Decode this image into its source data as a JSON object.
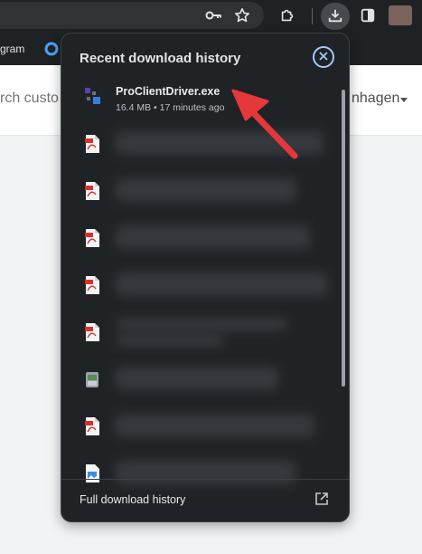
{
  "bookmarks": {
    "partial_label": "gram"
  },
  "page": {
    "search_fragment": "rch custo",
    "account_fragment": "nhagen"
  },
  "download_bubble": {
    "title": "Recent download history",
    "items": [
      {
        "name": "ProClientDriver.exe",
        "meta": "16.4 MB • 17 minutes ago",
        "icon": "exe-app-icon"
      },
      {
        "icon": "pdf-file-icon"
      },
      {
        "icon": "pdf-file-icon"
      },
      {
        "icon": "pdf-file-icon"
      },
      {
        "icon": "pdf-file-icon"
      },
      {
        "icon": "pdf-file-icon"
      },
      {
        "icon": "installer-file-icon"
      },
      {
        "icon": "pdf-file-icon"
      },
      {
        "icon": "image-file-icon"
      }
    ],
    "footer_label": "Full download history"
  },
  "colors": {
    "bubble_bg": "#1f2326",
    "accent": "#a8c7fa",
    "annotation_arrow": "#e5383b",
    "pdf_red": "#d9302c"
  }
}
